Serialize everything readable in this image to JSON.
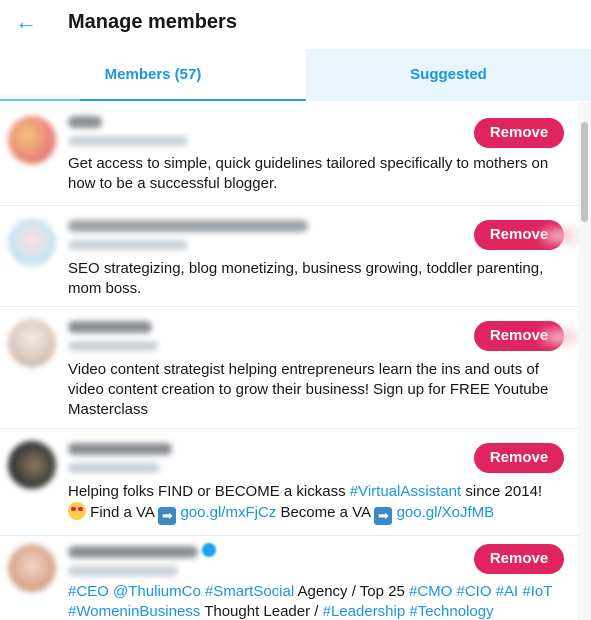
{
  "header": {
    "title": "Manage members",
    "back_icon": "arrow-left-icon"
  },
  "tabs": {
    "members_label": "Members (57)",
    "suggested_label": "Suggested"
  },
  "colors": {
    "accent": "#1da1f2",
    "remove": "#e0245e",
    "link": "#1b95e0"
  },
  "members": [
    {
      "remove_label": "Remove",
      "bio": "Get access to simple, quick guidelines tailored specifically to mothers on how to be a successful blogger."
    },
    {
      "remove_label": "Remove",
      "bio": "SEO strategizing, blog monetizing, business growing, toddler parenting, mom boss."
    },
    {
      "remove_label": "Remove",
      "bio": "Video content strategist helping entrepreneurs learn the ins and outs of video content creation to grow their business! Sign up for FREE Youtube Masterclass"
    },
    {
      "remove_label": "Remove",
      "bio_parts": {
        "t1": "Helping folks FIND or BECOME a kickass ",
        "tag1": "#VirtualAssistant",
        "t2": " since 2014!",
        "t3": " Find a VA ",
        "link1": "goo.gl/mxFjCz",
        "t4": " Become a VA ",
        "link2": "goo.gl/XoJfMB"
      }
    },
    {
      "remove_label": "Remove",
      "verified_icon": "verified-badge-icon",
      "bio_parts": {
        "tag1": "#CEO",
        "mention1": "@ThuliumCo",
        "tag2": "#SmartSocial",
        "t1": " Agency / Top 25 ",
        "tag3": "#CMO",
        "tag4": "#CIO",
        "tag5": "#AI",
        "tag6": "#IoT",
        "tag7": "#WomeninBusiness",
        "t2": " Thought Leader / ",
        "tag8": "#Leadership",
        "tag9": "#Technology"
      }
    }
  ]
}
